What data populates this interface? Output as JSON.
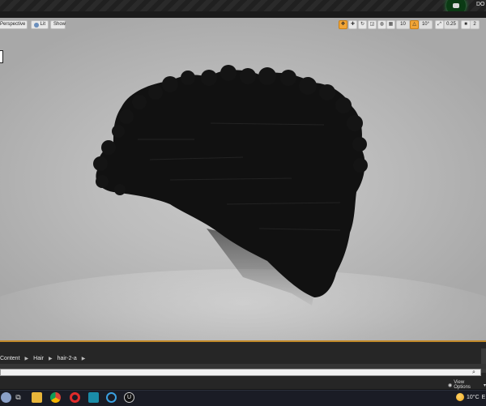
{
  "title_bar": {
    "right_text": "DO"
  },
  "viewport": {
    "buttons": {
      "perspective": "Perspective",
      "lit": "Lit",
      "show": "Show"
    },
    "toolbar": {
      "grid_snap": "10",
      "rotation_snap": "10°",
      "scale_snap": "0.25",
      "camera_speed": "2"
    }
  },
  "content_browser": {
    "breadcrumb": [
      "Content",
      "Hair",
      "hair-2-a"
    ],
    "view_options": "View Options"
  },
  "taskbar": {
    "temperature": "10°C",
    "extra": "E"
  }
}
